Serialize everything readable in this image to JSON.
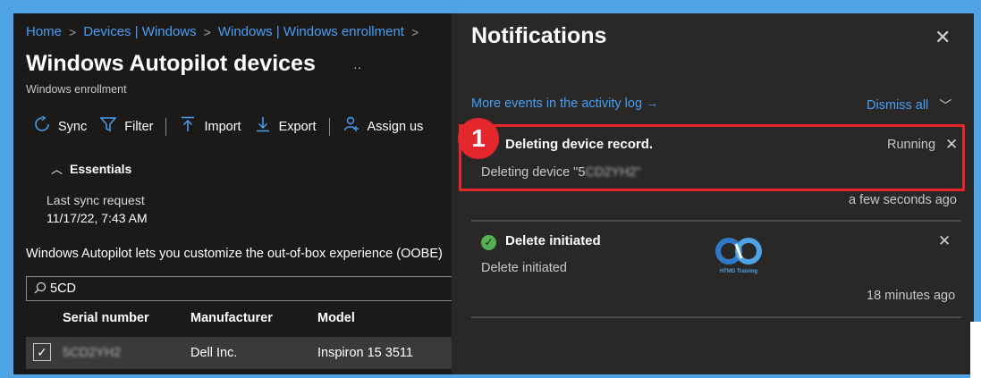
{
  "breadcrumb": [
    "Home",
    "Devices | Windows",
    "Windows | Windows enrollment"
  ],
  "page": {
    "title": "Windows Autopilot devices",
    "title_dots": "··",
    "subtitle": "Windows enrollment"
  },
  "toolbar": {
    "sync": "Sync",
    "filter": "Filter",
    "import": "Import",
    "export": "Export",
    "assign": "Assign us"
  },
  "essentials": {
    "label": "Essentials",
    "sync_label": "Last sync request",
    "sync_value": "11/17/22, 7:43 AM"
  },
  "description": "Windows Autopilot lets you customize the out-of-box experience (OOBE)",
  "search": {
    "value": "5CD"
  },
  "table": {
    "headers": [
      "Serial number",
      "Manufacturer",
      "Model"
    ],
    "rows": [
      {
        "serial": "5CD2YH2",
        "manufacturer": "Dell Inc.",
        "model": "Inspiron 15 3511"
      }
    ]
  },
  "notifications": {
    "title": "Notifications",
    "activity_link": "More events in the activity log →",
    "dismiss_all": "Dismiss all",
    "items": [
      {
        "title": "Deleting device record.",
        "status": "Running",
        "body": "Deleting device \"5",
        "body_blurred": "CD2YH2\"",
        "time": "a few seconds ago"
      },
      {
        "title": "Delete initiated",
        "body": "Delete initiated",
        "time": "18 minutes ago"
      }
    ]
  },
  "step_badge": "1",
  "logo_text": "HTMD Training",
  "colors": {
    "accent": "#479ef5",
    "highlight": "#e4262d",
    "success": "#54b054",
    "frame": "#4ea3e4"
  }
}
